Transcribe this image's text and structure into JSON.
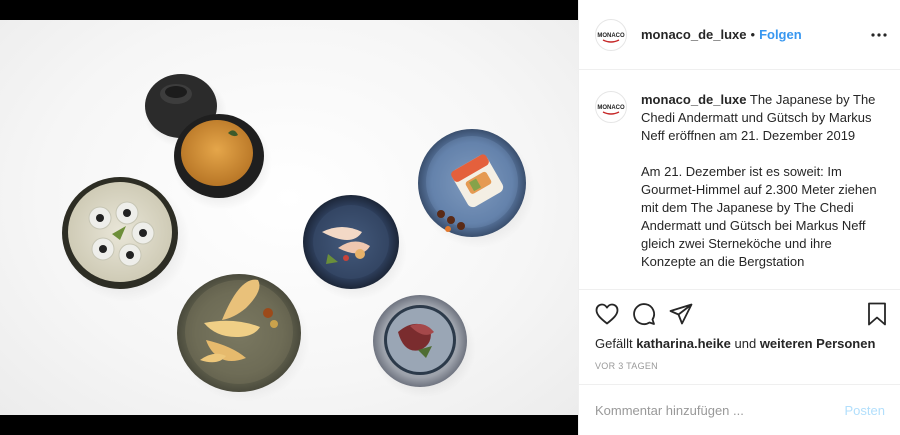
{
  "post": {
    "username": "monaco_de_luxe",
    "separator": "•",
    "follow_label": "Folgen",
    "avatar_text": "MONACO",
    "more_icon": "more-horizontal-icon"
  },
  "caption": {
    "username": "monaco_de_luxe",
    "title_text": "The Japanese by The Chedi Andermatt und Gütsch by Markus Neff eröffnen am 21. Dezember 2019",
    "body_text": "Am 21. Dezember ist es soweit: Im Gourmet-Himmel auf 2.300 Meter ziehen mit dem The Japanese by The Chedi Andermatt und Gütsch bei Markus Neff gleich zwei Sterneköche und ihre Konzepte an die Bergstation"
  },
  "actions": {
    "like_icon": "heart-icon",
    "comment_icon": "comment-icon",
    "share_icon": "share-icon",
    "save_icon": "bookmark-icon"
  },
  "likes": {
    "prefix": "Gefällt",
    "user": "katharina.heike",
    "middle": "und",
    "suffix": "weiteren Personen"
  },
  "timestamp": "VOR 3 TAGEN",
  "comment": {
    "placeholder": "Kommentar hinzufügen ...",
    "post_label": "Posten"
  },
  "colors": {
    "link_blue": "#3897f0",
    "disabled_blue": "#b2dffc",
    "border": "#efefef",
    "muted_text": "#999999"
  }
}
